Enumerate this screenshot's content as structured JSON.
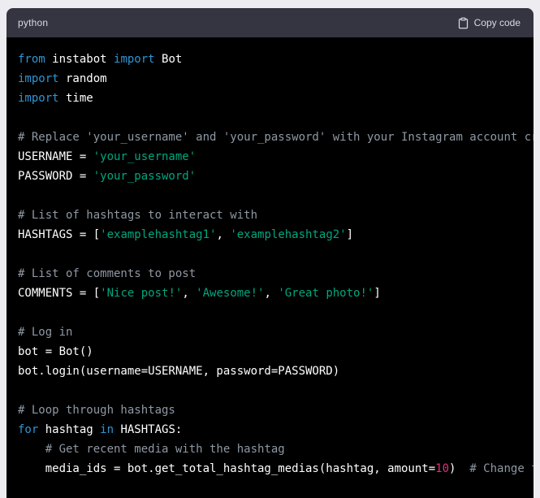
{
  "header": {
    "language": "python",
    "copy_label": "Copy code"
  },
  "colors": {
    "page-bg": "#ececf1",
    "header-bg": "#343541",
    "header-text": "#d9d9e3",
    "code-bg": "#000000",
    "code-text": "#ffffff",
    "kw": "#2e95d3",
    "str": "#00a67d",
    "com": "#8e98a3",
    "num": "#df3079"
  },
  "code": {
    "lines": [
      [
        [
          "kw",
          "from"
        ],
        [
          "pl",
          " instabot "
        ],
        [
          "kw",
          "import"
        ],
        [
          "pl",
          " Bot"
        ]
      ],
      [
        [
          "kw",
          "import"
        ],
        [
          "pl",
          " random"
        ]
      ],
      [
        [
          "kw",
          "import"
        ],
        [
          "pl",
          " time"
        ]
      ],
      [],
      [
        [
          "com",
          "# Replace 'your_username' and 'your_password' with your Instagram account cr"
        ]
      ],
      [
        [
          "pl",
          "USERNAME = "
        ],
        [
          "str",
          "'your_username'"
        ]
      ],
      [
        [
          "pl",
          "PASSWORD = "
        ],
        [
          "str",
          "'your_password'"
        ]
      ],
      [],
      [
        [
          "com",
          "# List of hashtags to interact with"
        ]
      ],
      [
        [
          "pl",
          "HASHTAGS = ["
        ],
        [
          "str",
          "'examplehashtag1'"
        ],
        [
          "pl",
          ", "
        ],
        [
          "str",
          "'examplehashtag2'"
        ],
        [
          "pl",
          "]"
        ]
      ],
      [],
      [
        [
          "com",
          "# List of comments to post"
        ]
      ],
      [
        [
          "pl",
          "COMMENTS = ["
        ],
        [
          "str",
          "'Nice post!'"
        ],
        [
          "pl",
          ", "
        ],
        [
          "str",
          "'Awesome!'"
        ],
        [
          "pl",
          ", "
        ],
        [
          "str",
          "'Great photo!'"
        ],
        [
          "pl",
          "]"
        ]
      ],
      [],
      [
        [
          "com",
          "# Log in"
        ]
      ],
      [
        [
          "pl",
          "bot = Bot()"
        ]
      ],
      [
        [
          "pl",
          "bot.login(username=USERNAME, password=PASSWORD)"
        ]
      ],
      [],
      [
        [
          "com",
          "# Loop through hashtags"
        ]
      ],
      [
        [
          "kw",
          "for"
        ],
        [
          "pl",
          " hashtag "
        ],
        [
          "kw",
          "in"
        ],
        [
          "pl",
          " HASHTAGS:"
        ]
      ],
      [
        [
          "pl",
          "    "
        ],
        [
          "com",
          "# Get recent media with the hashtag"
        ]
      ],
      [
        [
          "pl",
          "    media_ids = bot.get_total_hashtag_medias(hashtag, amount="
        ],
        [
          "num",
          "10"
        ],
        [
          "pl",
          ")  "
        ],
        [
          "com",
          "# Change t"
        ]
      ]
    ]
  }
}
